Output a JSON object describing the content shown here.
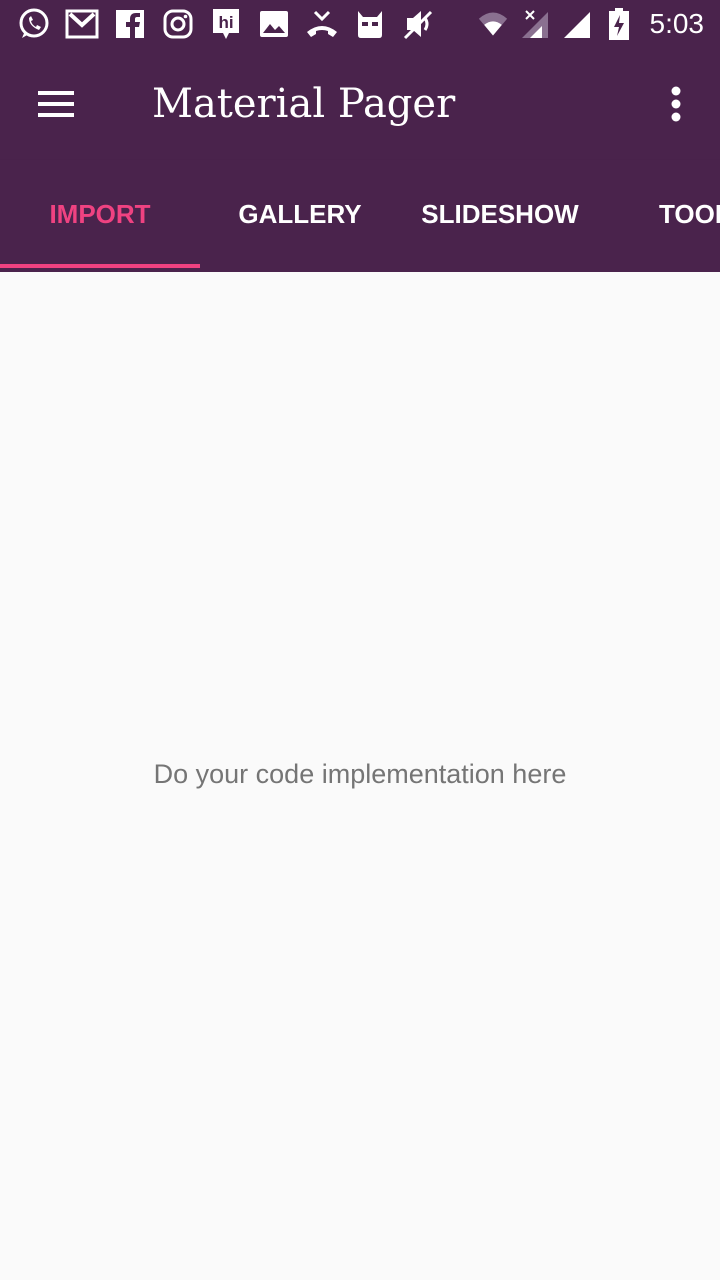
{
  "status_bar": {
    "time": "5:03",
    "left_icons": [
      "whatsapp-icon",
      "gmail-icon",
      "facebook-icon",
      "instagram-icon",
      "hike-icon",
      "gallery-icon",
      "missed-call-icon",
      "cyanogen-icon",
      "mute-icon"
    ],
    "right_icons": [
      "wifi-icon",
      "signal-no-data-icon",
      "signal-icon",
      "battery-charging-icon"
    ]
  },
  "toolbar": {
    "title": "Material Pager",
    "menu_icon": "hamburger-menu-icon",
    "overflow_icon": "more-vert-icon",
    "background": "#4a234c"
  },
  "tabs": [
    {
      "label": "IMPORT",
      "active": true
    },
    {
      "label": "GALLERY",
      "active": false
    },
    {
      "label": "SLIDESHOW",
      "active": false
    },
    {
      "label": "TOOLS",
      "active": false
    }
  ],
  "accent_color": "#ef4281",
  "content": {
    "message": "Do your code implementation here"
  }
}
